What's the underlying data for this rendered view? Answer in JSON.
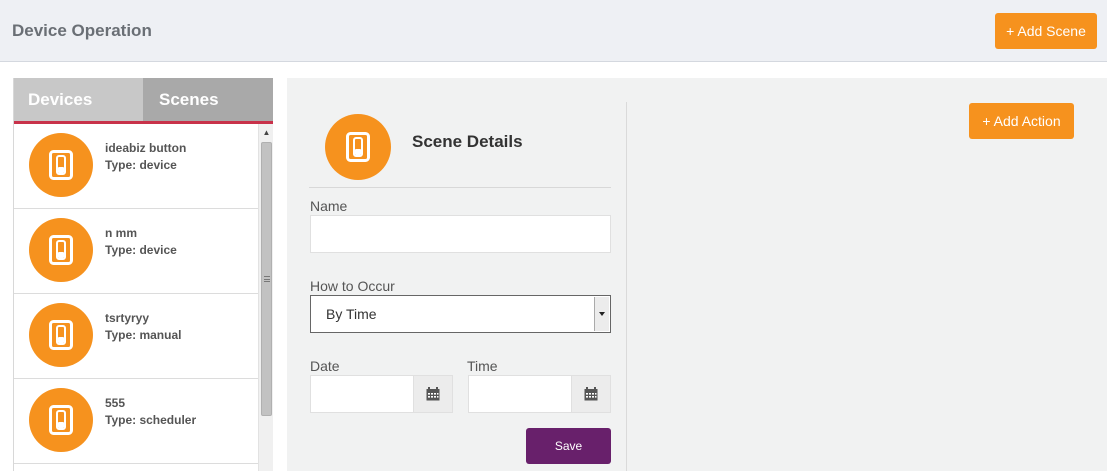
{
  "header": {
    "title": "Device Operation",
    "add_scene_label": "+ Add Scene"
  },
  "tabs": [
    {
      "label": "Devices",
      "active": false
    },
    {
      "label": "Scenes",
      "active": true
    }
  ],
  "scenes": [
    {
      "name": "ideabiz button",
      "type": "Type: device"
    },
    {
      "name": "n mm",
      "type": "Type: device"
    },
    {
      "name": "tsrtyryy",
      "type": "Type: manual"
    },
    {
      "name": "555",
      "type": "Type: scheduler"
    }
  ],
  "scene_details": {
    "title": "Scene Details",
    "name_label": "Name",
    "name_value": "",
    "occur_label": "How to Occur",
    "occur_value": "By Time",
    "date_label": "Date",
    "date_value": "",
    "time_label": "Time",
    "time_value": "",
    "save_label": "Save"
  },
  "actions": {
    "add_action_label": "+ Add Action"
  },
  "colors": {
    "accent": "#f6921e",
    "save": "#68206b",
    "tab_underline": "#c8324a"
  },
  "icons": {
    "scene_icon": "switch-icon",
    "calendar": "calendar-icon",
    "dropdown": "chevron-down-icon"
  }
}
